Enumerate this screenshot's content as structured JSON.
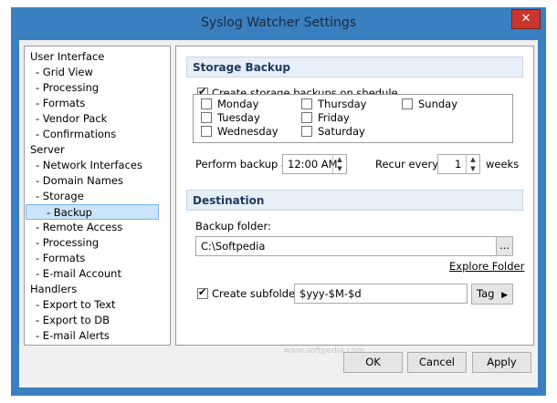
{
  "window": {
    "title": "Syslog Watcher Settings",
    "close_glyph": "✕"
  },
  "tree": [
    {
      "label": "User Interface",
      "indent": 0
    },
    {
      "label": "-   Grid View",
      "indent": 1
    },
    {
      "label": "-   Processing",
      "indent": 1
    },
    {
      "label": "-   Formats",
      "indent": 1
    },
    {
      "label": "-   Vendor Pack",
      "indent": 1
    },
    {
      "label": "-   Confirmations",
      "indent": 1
    },
    {
      "label": "Server",
      "indent": 0
    },
    {
      "label": "-   Network Interfaces",
      "indent": 1
    },
    {
      "label": "-   Domain Names",
      "indent": 1
    },
    {
      "label": "-   Storage",
      "indent": 1
    },
    {
      "label": "-   Backup",
      "indent": 2,
      "selected": true
    },
    {
      "label": "-   Remote Access",
      "indent": 1
    },
    {
      "label": "-   Processing",
      "indent": 1
    },
    {
      "label": "-   Formats",
      "indent": 1
    },
    {
      "label": "-   E-mail Account",
      "indent": 1
    },
    {
      "label": "Handlers",
      "indent": 0
    },
    {
      "label": "-   Export to Text",
      "indent": 1
    },
    {
      "label": "-   Export to DB",
      "indent": 1
    },
    {
      "label": "-   E-mail Alerts",
      "indent": 1
    }
  ],
  "storage_backup": {
    "header": "Storage Backup",
    "create_backups_label": "Create storage backups on shedule",
    "create_backups_checked": true,
    "days": {
      "monday": "Monday",
      "tuesday": "Tuesday",
      "wednesday": "Wednesday",
      "thursday": "Thursday",
      "friday": "Friday",
      "saturday": "Saturday",
      "sunday": "Sunday"
    },
    "perform_at_label": "Perform backup at:",
    "perform_at_value": "12:00 AM",
    "recur_label": "Recur every:",
    "recur_value": "1",
    "recur_unit": "weeks"
  },
  "destination": {
    "header": "Destination",
    "folder_label": "Backup folder:",
    "folder_value": "C:\\Softpedia",
    "browse_label": "...",
    "explore_link": "Explore Folder",
    "subfolder_label": "Create subfolder:",
    "subfolder_checked": true,
    "subfolder_value": "$yyy-$M-$d",
    "tag_label": "Tag",
    "tag_arrow": "▶"
  },
  "watermark": "www.softpedia.com",
  "buttons": {
    "ok": "OK",
    "cancel": "Cancel",
    "apply": "Apply"
  },
  "colors": {
    "title_bar": "#3a7fbf",
    "close_button": "#c7372f",
    "section_header": "#e6eef7",
    "selection": "#cce4f7"
  }
}
